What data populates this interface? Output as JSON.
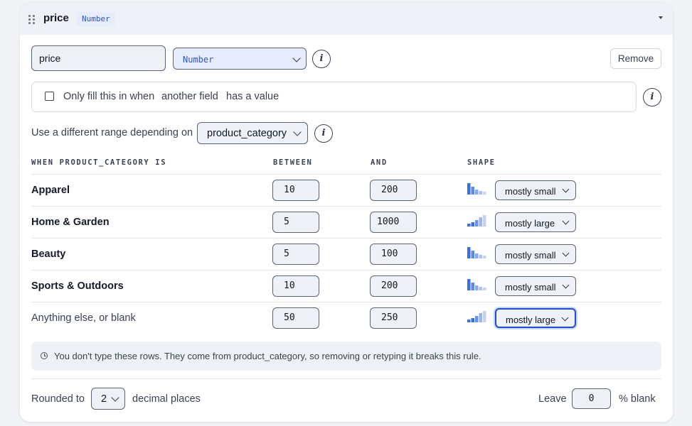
{
  "header": {
    "title": "price",
    "type_badge": "Number"
  },
  "field": {
    "name_value": "price",
    "type_value": "Number",
    "remove_label": "Remove"
  },
  "condition": {
    "text_1": "Only fill this in when",
    "text_2": "another field",
    "text_3": "has a value",
    "checked": false
  },
  "range": {
    "label": "Use a different range depending on",
    "selected": "product_category"
  },
  "table": {
    "headers": {
      "when": "WHEN PRODUCT_CATEGORY IS",
      "between": "BETWEEN",
      "and": "AND",
      "shape": "SHAPE"
    },
    "rows": [
      {
        "label": "Apparel",
        "between": "10",
        "and": "200",
        "shape": "mostly small"
      },
      {
        "label": "Home & Garden",
        "between": "5",
        "and": "1000",
        "shape": "mostly large"
      },
      {
        "label": "Beauty",
        "between": "5",
        "and": "100",
        "shape": "mostly small"
      },
      {
        "label": "Sports & Outdoors",
        "between": "10",
        "and": "200",
        "shape": "mostly small"
      },
      {
        "label": "Anything else, or blank",
        "between": "50",
        "and": "250",
        "shape": "mostly large"
      }
    ]
  },
  "note": {
    "text": "You don't type these rows. They come from product_category, so removing or retyping it breaks this rule."
  },
  "footer": {
    "rounded_label": "Rounded to",
    "decimal_value": "2",
    "decimal_suffix": "decimal places",
    "leave_label": "Leave",
    "blank_value": "0",
    "blank_suffix": "% blank"
  },
  "colors": {
    "accent": "#1d4fd1",
    "bar_dark": "#3b6fe0",
    "bar_light": "#b3c6f3"
  },
  "icons": {
    "drag": "drag-handle-icon",
    "collapse": "chevron-down-icon",
    "info": "info-icon",
    "note": "clock-icon"
  }
}
